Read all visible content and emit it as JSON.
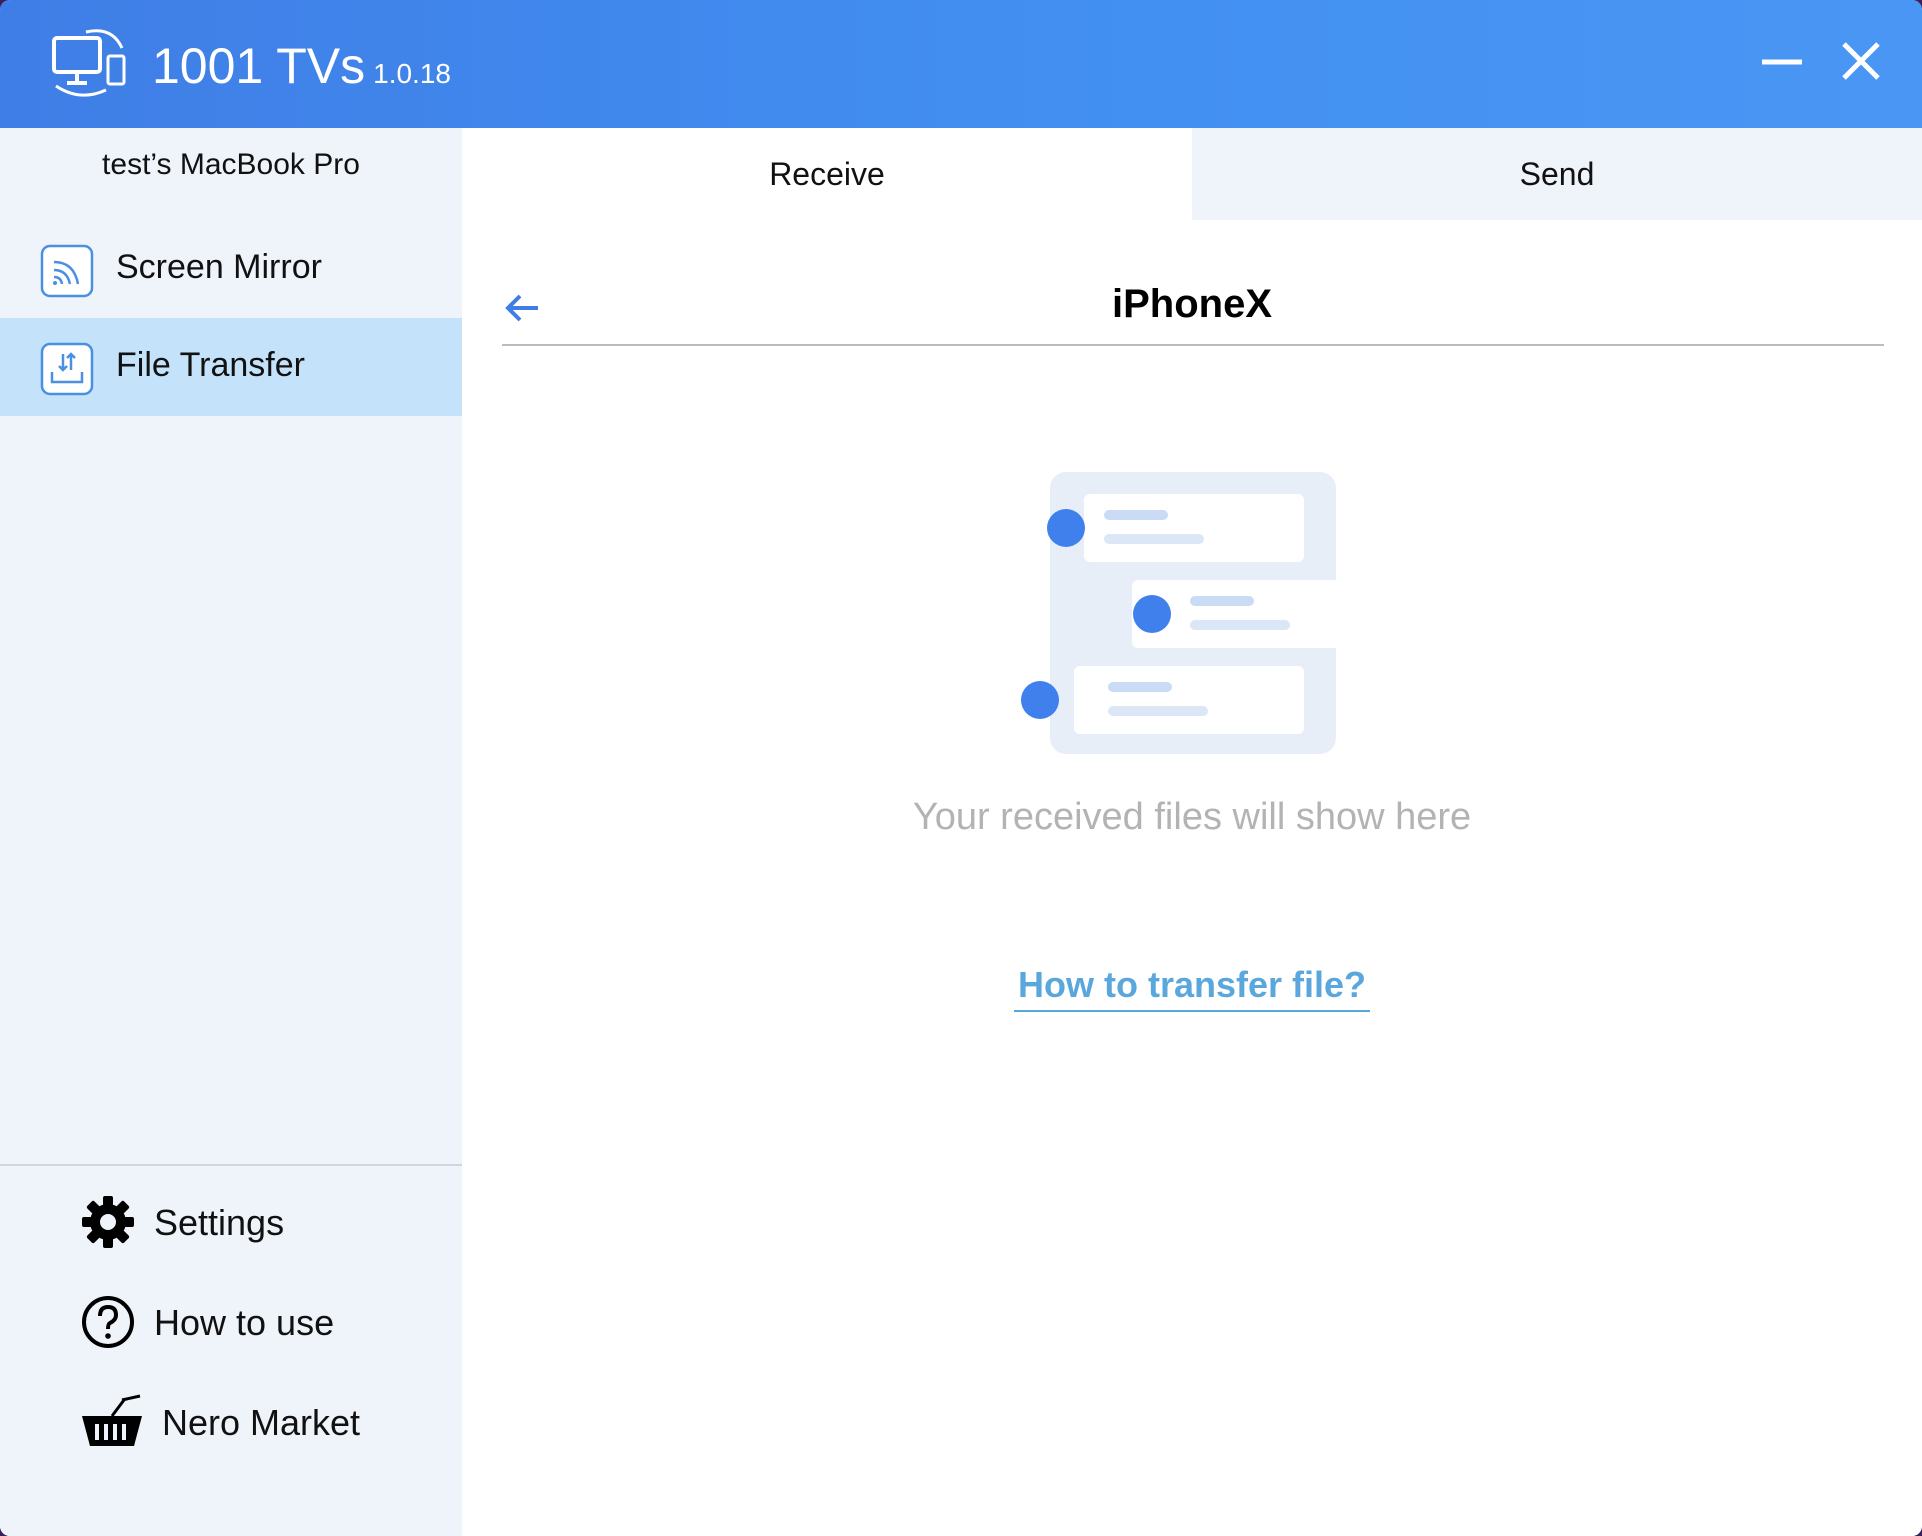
{
  "app": {
    "title": "1001 TVs",
    "version": "1.0.18"
  },
  "window_controls": {
    "minimize_icon": "minimize-icon",
    "close_icon": "close-icon"
  },
  "sidebar": {
    "device_name": "test’s MacBook Pro",
    "nav_items": [
      {
        "label": "Screen Mirror",
        "icon": "screen-mirror-icon",
        "active": false
      },
      {
        "label": "File Transfer",
        "icon": "file-transfer-icon",
        "active": true
      }
    ],
    "bottom_items": [
      {
        "label": "Settings",
        "icon": "gear-icon"
      },
      {
        "label": "How to use",
        "icon": "question-circle-icon"
      },
      {
        "label": "Nero Market",
        "icon": "basket-icon"
      }
    ]
  },
  "main": {
    "tabs": [
      {
        "label": "Receive",
        "active": true
      },
      {
        "label": "Send",
        "active": false
      }
    ],
    "device_title": "iPhoneX",
    "empty_message": "Your received files will show here",
    "help_link": "How to transfer file?"
  },
  "colors": {
    "accent": "#3f7ee6",
    "sidebar_bg": "#eff4fb",
    "active_item_bg": "#c5e2fb",
    "link": "#5aa7de",
    "muted_text": "#b3b3b3"
  }
}
